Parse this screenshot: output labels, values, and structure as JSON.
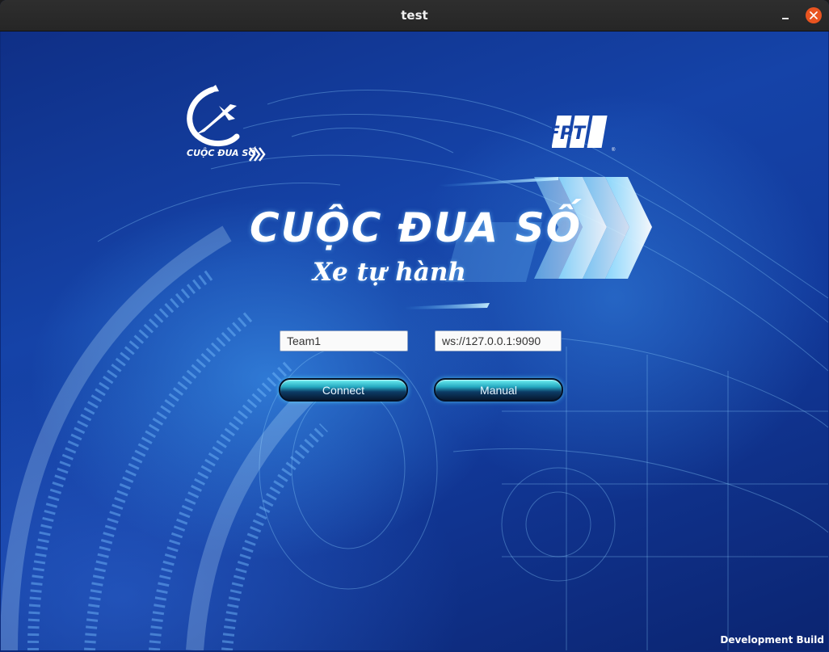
{
  "window": {
    "title": "test"
  },
  "logos": {
    "left_logo_text": "CUỘC ĐUA SỐ",
    "right_logo_text": "FPT"
  },
  "banner": {
    "title": "CUỘC ĐUA SỐ",
    "subtitle": "Xe tự hành"
  },
  "form": {
    "team_value": "Team1",
    "server_value": "ws://127.0.0.1:9090"
  },
  "buttons": {
    "connect_label": "Connect",
    "manual_label": "Manual"
  },
  "footer": {
    "build_label": "Development Build"
  },
  "icons": {
    "minimize": "minimize-icon",
    "close": "close-icon"
  },
  "colors": {
    "close_button": "#e95420",
    "background": "#1543a8",
    "button_glow": "#6ef0f3"
  }
}
